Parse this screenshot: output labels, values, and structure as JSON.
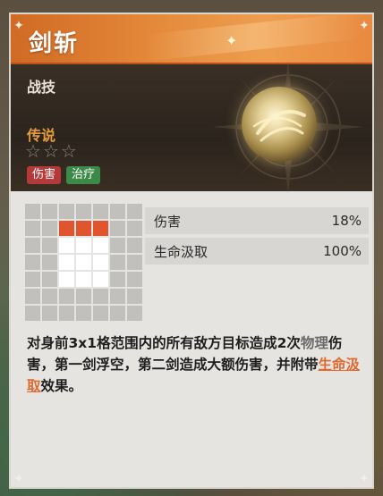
{
  "skill": {
    "title": "剑斩",
    "type": "战技",
    "rarity": "传说",
    "stars": [
      "☆",
      "☆",
      "☆"
    ],
    "tags": [
      {
        "label": "伤害",
        "color": "#b43a3a"
      },
      {
        "label": "治疗",
        "color": "#3b8a48"
      }
    ],
    "icon": "sword-slash-orb-icon"
  },
  "range_grid": {
    "rows": 7,
    "cols": 7,
    "cells": [
      [
        "gray",
        "gray",
        "gray",
        "gray",
        "gray",
        "gray",
        "gray"
      ],
      [
        "gray",
        "gray",
        "red",
        "red",
        "red",
        "gray",
        "gray"
      ],
      [
        "gray",
        "gray",
        "white",
        "white",
        "white",
        "gray",
        "gray"
      ],
      [
        "gray",
        "gray",
        "white",
        "white",
        "white",
        "gray",
        "gray"
      ],
      [
        "gray",
        "gray",
        "white",
        "white",
        "white",
        "gray",
        "gray"
      ],
      [
        "gray",
        "gray",
        "gray",
        "gray",
        "gray",
        "gray",
        "gray"
      ],
      [
        "gray",
        "gray",
        "gray",
        "gray",
        "gray",
        "gray",
        "gray"
      ]
    ]
  },
  "stats": [
    {
      "label": "伤害",
      "value": "18%"
    },
    {
      "label": "生命汲取",
      "value": "100%"
    }
  ],
  "description": {
    "part1": "对身前3x1格范围内的所有敌方目标造成2次",
    "keyword1": "物理",
    "part2": "伤害，第一剑浮空，第二剑造成大额伤害，并附带",
    "keyword2": "生命汲取",
    "part3": "效果。"
  },
  "colors": {
    "header": "#e4893a",
    "rarity": "#e79a3e",
    "highlight": "#e0552d"
  }
}
